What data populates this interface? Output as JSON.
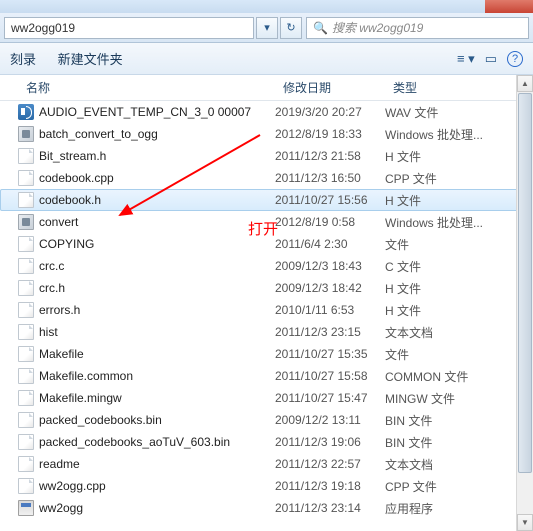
{
  "window": {
    "path": "ww2ogg019",
    "search_placeholder": "搜索 ww2ogg019"
  },
  "toolbar": {
    "burn": "刻录",
    "new_folder": "新建文件夹"
  },
  "columns": {
    "name": "名称",
    "date": "修改日期",
    "type": "类型"
  },
  "annotation": {
    "label": "打开"
  },
  "files": [
    {
      "icon": "audio",
      "name": "AUDIO_EVENT_TEMP_CN_3_0 00007",
      "date": "2019/3/20 20:27",
      "type": "WAV 文件"
    },
    {
      "icon": "bat",
      "name": "batch_convert_to_ogg",
      "date": "2012/8/19 18:33",
      "type": "Windows 批处理..."
    },
    {
      "icon": "file",
      "name": "Bit_stream.h",
      "date": "2011/12/3 21:58",
      "type": "H 文件"
    },
    {
      "icon": "file",
      "name": "codebook.cpp",
      "date": "2011/12/3 16:50",
      "type": "CPP 文件"
    },
    {
      "icon": "file",
      "name": "codebook.h",
      "date": "2011/10/27 15:56",
      "type": "H 文件",
      "selected": true
    },
    {
      "icon": "bat",
      "name": "convert",
      "date": "2012/8/19 0:58",
      "type": "Windows 批处理..."
    },
    {
      "icon": "file",
      "name": "COPYING",
      "date": "2011/6/4 2:30",
      "type": "文件"
    },
    {
      "icon": "file",
      "name": "crc.c",
      "date": "2009/12/3 18:43",
      "type": "C 文件"
    },
    {
      "icon": "file",
      "name": "crc.h",
      "date": "2009/12/3 18:42",
      "type": "H 文件"
    },
    {
      "icon": "file",
      "name": "errors.h",
      "date": "2010/1/11 6:53",
      "type": "H 文件"
    },
    {
      "icon": "file",
      "name": "hist",
      "date": "2011/12/3 23:15",
      "type": "文本文档"
    },
    {
      "icon": "file",
      "name": "Makefile",
      "date": "2011/10/27 15:35",
      "type": "文件"
    },
    {
      "icon": "file",
      "name": "Makefile.common",
      "date": "2011/10/27 15:58",
      "type": "COMMON 文件"
    },
    {
      "icon": "file",
      "name": "Makefile.mingw",
      "date": "2011/10/27 15:47",
      "type": "MINGW 文件"
    },
    {
      "icon": "file",
      "name": "packed_codebooks.bin",
      "date": "2009/12/2 13:11",
      "type": "BIN 文件"
    },
    {
      "icon": "file",
      "name": "packed_codebooks_aoTuV_603.bin",
      "date": "2011/12/3 19:06",
      "type": "BIN 文件"
    },
    {
      "icon": "file",
      "name": "readme",
      "date": "2011/12/3 22:57",
      "type": "文本文档"
    },
    {
      "icon": "file",
      "name": "ww2ogg.cpp",
      "date": "2011/12/3 19:18",
      "type": "CPP 文件"
    },
    {
      "icon": "exe",
      "name": "ww2ogg",
      "date": "2011/12/3 23:14",
      "type": "应用程序"
    }
  ]
}
